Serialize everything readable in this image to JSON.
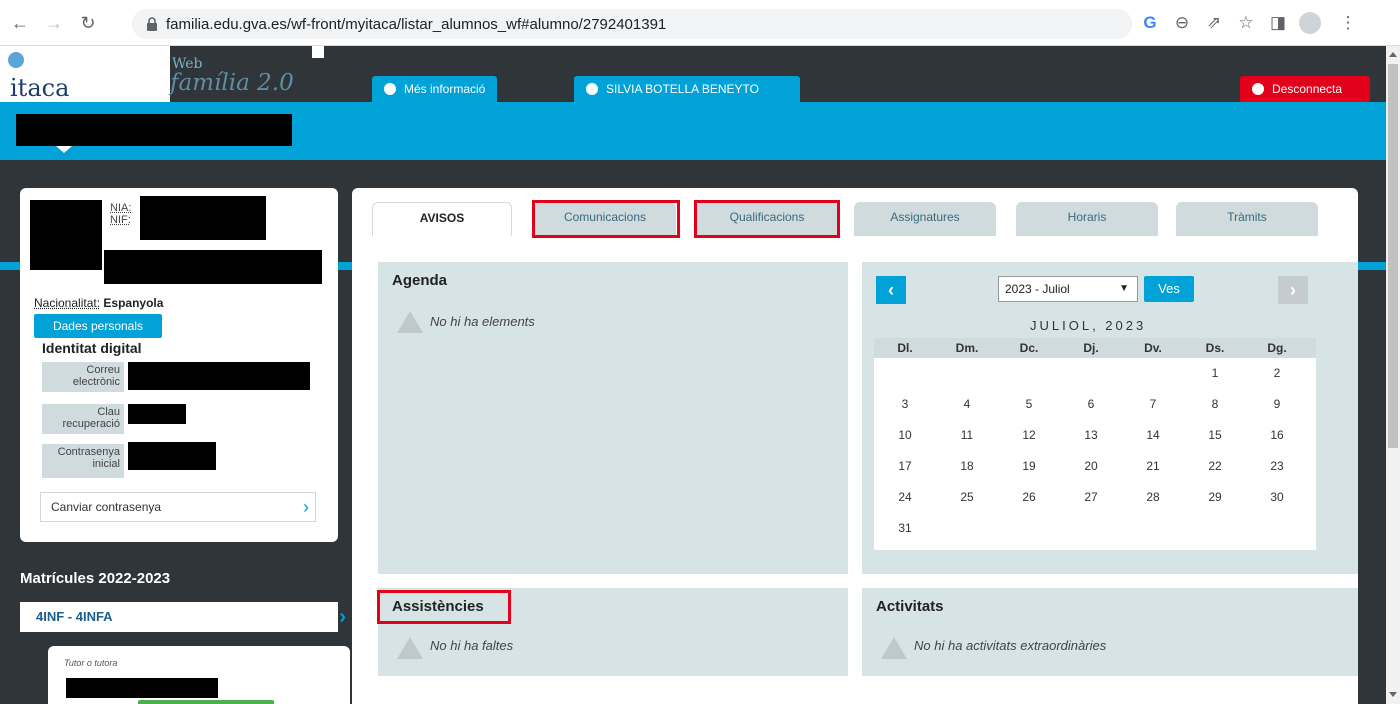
{
  "browser": {
    "url": "familia.edu.gva.es/wf-front/myitaca/listar_alumnos_wf#alumno/2792401391"
  },
  "header": {
    "logo": "itaca",
    "web": "Web",
    "familia": "família 2.0",
    "mes_info": "Més informació",
    "user": "SILVIA BOTELLA BENEYTO",
    "disconnect": "Desconnecta"
  },
  "student": {
    "nia_label": "NIA:",
    "nif_label": "NIF:",
    "nacionalitat_label": "Nacionalitat:",
    "nacionalitat_value": "Espanyola",
    "dades_button": "Dades personals",
    "identitat_title": "Identitat digital",
    "correu_label": "Correu electrònic",
    "clau_label": "Clau recuperació",
    "contrasenya_label": "Contrasenya inicial",
    "canviar": "Canviar contrasenya"
  },
  "matricules": {
    "title": "Matrícules 2022-2023",
    "item": "4INF - 4INFA",
    "tutor_label": "Tutor o tutora"
  },
  "tabs": [
    "AVISOS",
    "Comunicacions",
    "Qualificacions",
    "Assignatures",
    "Horaris",
    "Tràmits"
  ],
  "agenda": {
    "title": "Agenda",
    "empty": "No hi ha elements"
  },
  "assistencies": {
    "title": "Assistències",
    "empty": "No hi ha faltes"
  },
  "activitats": {
    "title": "Activitats",
    "empty": "No hi ha activitats extraordinàries"
  },
  "calendar": {
    "select_value": "2023 - Juliol",
    "ves": "Ves",
    "month_label": "JULIOL, 2023",
    "weekdays": [
      "Dl.",
      "Dm.",
      "Dc.",
      "Dj.",
      "Dv.",
      "Ds.",
      "Dg."
    ],
    "weeks": [
      [
        "",
        "",
        "",
        "",
        "",
        "1",
        "2"
      ],
      [
        "3",
        "4",
        "5",
        "6",
        "7",
        "8",
        "9"
      ],
      [
        "10",
        "11",
        "12",
        "13",
        "14",
        "15",
        "16"
      ],
      [
        "17",
        "18",
        "19",
        "20",
        "21",
        "22",
        "23"
      ],
      [
        "24",
        "25",
        "26",
        "27",
        "28",
        "29",
        "30"
      ],
      [
        "31",
        "",
        "",
        "",
        "",
        "",
        ""
      ]
    ]
  },
  "colors": {
    "accent": "#00a2d8",
    "danger": "#e2001a",
    "dark": "#2f3539",
    "panel": "#d6e4e6"
  }
}
